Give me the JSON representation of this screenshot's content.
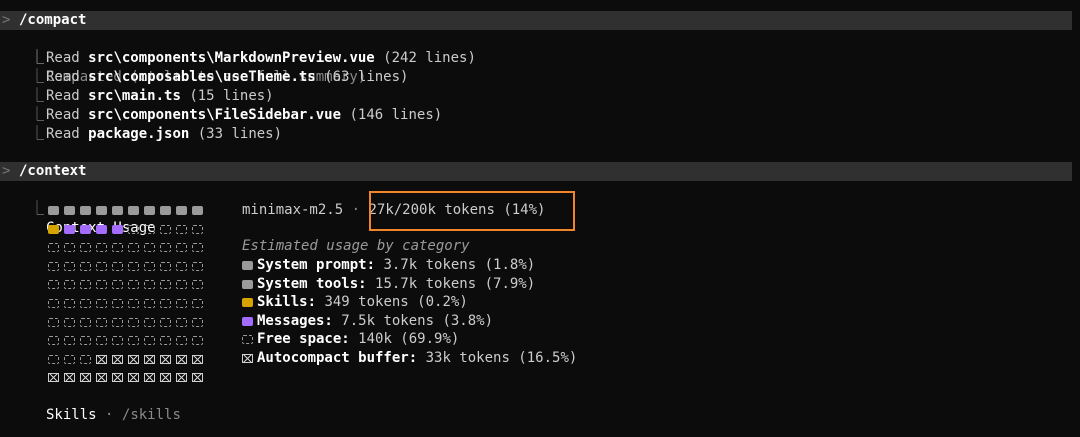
{
  "compact": {
    "caret": ">",
    "command": "/compact",
    "tree_glyph": "⎿",
    "summary_note": "Compacted (ctrl+o to see full summary)",
    "reads": [
      {
        "verb": "Read",
        "path": "src\\components\\MarkdownPreview.vue",
        "info": "(242 lines)"
      },
      {
        "verb": "Read",
        "path": "src\\composables\\useTheme.ts",
        "info": "(63 lines)"
      },
      {
        "verb": "Read",
        "path": "src\\main.ts",
        "info": "(15 lines)"
      },
      {
        "verb": "Read",
        "path": "src\\components\\FileSidebar.vue",
        "info": "(146 lines)"
      },
      {
        "verb": "Read",
        "path": "package.json",
        "info": "(33 lines)"
      }
    ]
  },
  "context": {
    "caret": ">",
    "command": "/context",
    "heading": "Context Usage",
    "model": "minimax-m2.5",
    "separator": "·",
    "tokens": "27k/200k tokens (14%)",
    "category_title": "Estimated usage by category",
    "categories": [
      {
        "label": "System prompt:",
        "value": "3.7k tokens (1.8%)",
        "kind": "used"
      },
      {
        "label": "System tools:",
        "value": "15.7k tokens (7.9%)",
        "kind": "used"
      },
      {
        "label": "Skills:",
        "value": "349 tokens (0.2%)",
        "kind": "skill"
      },
      {
        "label": "Messages:",
        "value": "7.5k tokens (3.8%)",
        "kind": "msg"
      },
      {
        "label": "Free space:",
        "value": "140k (69.9%)",
        "kind": "free"
      },
      {
        "label": "Autocompact buffer:",
        "value": "33k tokens (16.5%)",
        "kind": "buf"
      }
    ],
    "grid": [
      [
        "used",
        "used",
        "used",
        "used",
        "used",
        "used",
        "used",
        "used",
        "used",
        "used"
      ],
      [
        "skill",
        "msg",
        "msg",
        "msg",
        "msg",
        "free",
        "free",
        "free",
        "free",
        "free"
      ],
      [
        "free",
        "free",
        "free",
        "free",
        "free",
        "free",
        "free",
        "free",
        "free",
        "free"
      ],
      [
        "free",
        "free",
        "free",
        "free",
        "free",
        "free",
        "free",
        "free",
        "free",
        "free"
      ],
      [
        "free",
        "free",
        "free",
        "free",
        "free",
        "free",
        "free",
        "free",
        "free",
        "free"
      ],
      [
        "free",
        "free",
        "free",
        "free",
        "free",
        "free",
        "free",
        "free",
        "free",
        "free"
      ],
      [
        "free",
        "free",
        "free",
        "free",
        "free",
        "free",
        "free",
        "free",
        "free",
        "free"
      ],
      [
        "free",
        "free",
        "free",
        "free",
        "free",
        "free",
        "free",
        "free",
        "free",
        "free"
      ],
      [
        "free",
        "free",
        "free",
        "buf",
        "buf",
        "buf",
        "buf",
        "buf",
        "buf",
        "buf"
      ],
      [
        "buf",
        "buf",
        "buf",
        "buf",
        "buf",
        "buf",
        "buf",
        "buf",
        "buf",
        "buf"
      ]
    ],
    "skills_label": "Skills",
    "skills_sep": "·",
    "skills_cmd": "/skills"
  },
  "colors": {
    "skill": "#d6a400",
    "msg": "#a46bff",
    "highlight": "#f2852a"
  }
}
